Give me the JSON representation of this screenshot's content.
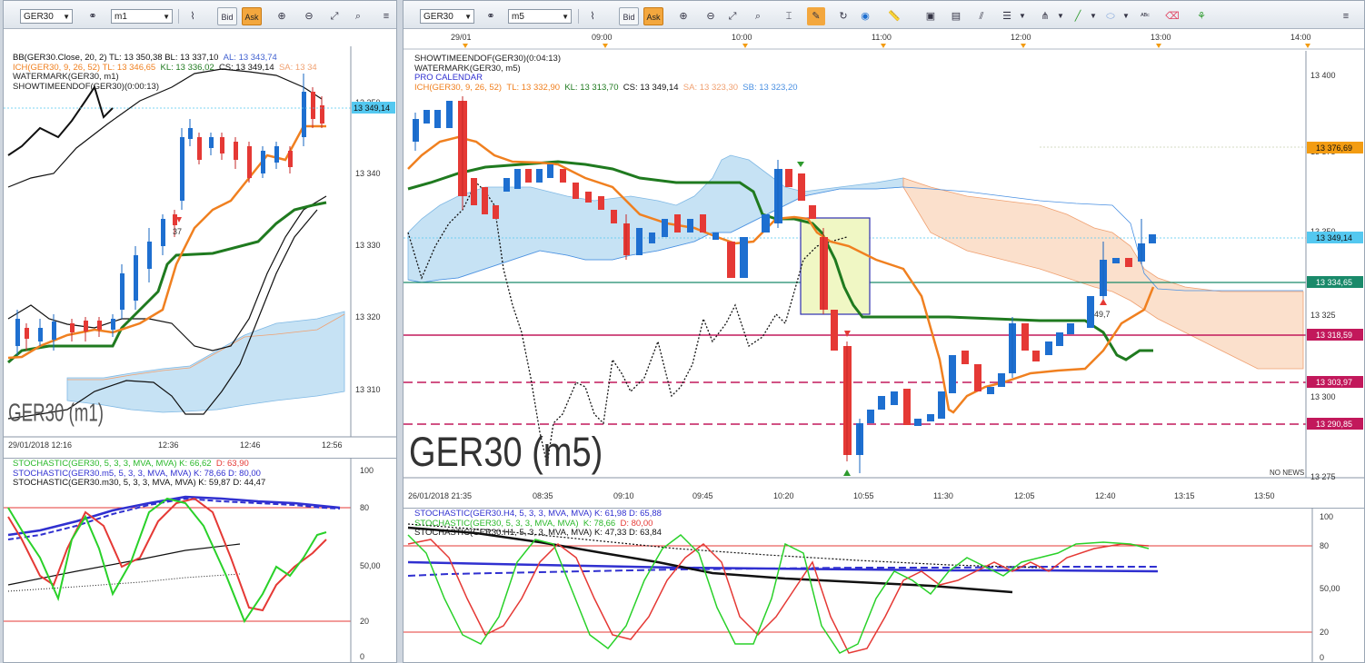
{
  "left": {
    "toolbar": {
      "symbol": "GER30",
      "timeframe": "m1",
      "bid_label": "Bid",
      "ask_label": "Ask"
    },
    "legend": {
      "bb": "BB(GER30.Close, 20, 2)  TL: 13 350,38  BL: 13 337,10",
      "bb_al": "AL: 13 343,74",
      "ich": "ICH(GER30, 9, 26, 52)  TL: 13 346,65",
      "ich_kl": "KL: 13 336,02",
      "ich_cs": "CS: 13 349,14",
      "ich_sa": "SA: 13 34",
      "wm": "WATERMARK(GER30, m1)",
      "ste": "SHOWTIMEENDOF(GER30)(0:00:13)"
    },
    "watermark": "GER30 (m1)",
    "price_tag": "13 349,14",
    "y_ticks": [
      "13 350",
      "13 340",
      "13 330",
      "13 320",
      "13 310"
    ],
    "x_ticks": [
      "29/01/2018 12:16",
      "12:36",
      "12:46",
      "12:56"
    ],
    "marker_label": "37",
    "stoch": {
      "l1": "STOCHASTIC(GER30, 5, 3, 3, MVA, MVA)  K: 66,62",
      "l1d": "D: 63,90",
      "l2": "STOCHASTIC(GER30.m5, 5, 3, 3, MVA, MVA)  K: 78,66  D: 80,00",
      "l3": "STOCHASTIC(GER30.m30, 5, 3, 3, MVA, MVA)  K: 59,87  D: 44,47",
      "y_ticks": [
        "100",
        "80",
        "50,00",
        "20",
        "0"
      ]
    }
  },
  "right": {
    "toolbar": {
      "symbol": "GER30",
      "timeframe": "m5",
      "bid_label": "Bid",
      "ask_label": "Ask"
    },
    "top_time_ticks": [
      "29/01",
      "09:00",
      "10:00",
      "11:00",
      "12:00",
      "13:00",
      "14:00"
    ],
    "legend": {
      "ste": "SHOWTIMEENDOF(GER30)(0:04:13)",
      "wm": "WATERMARK(GER30, m5)",
      "pc": "PRO CALENDAR",
      "ich": "ICH(GER30, 9, 26, 52)",
      "ich_tl": "TL: 13 332,90",
      "ich_kl": "KL: 13 313,70",
      "ich_cs": "CS: 13 349,14",
      "ich_sa": "SA: 13 323,30",
      "ich_sb": "SB: 13 323,20"
    },
    "watermark": "GER30 (m5)",
    "no_news": "NO NEWS",
    "marker_label": "49,7",
    "y_ticks": [
      "13 400",
      "13 375",
      "13 350",
      "13 325",
      "13 300",
      "13 275"
    ],
    "price_tags": [
      {
        "text": "13 376,69",
        "color": "#f39c12"
      },
      {
        "text": "13 349,14",
        "color": "#54c8f0"
      },
      {
        "text": "13 334,65",
        "color": "#1a8a6a"
      },
      {
        "text": "13 318,59",
        "color": "#c2185b"
      },
      {
        "text": "13 303,97",
        "color": "#c2185b"
      },
      {
        "text": "13 290,85",
        "color": "#c2185b"
      }
    ],
    "x_ticks": [
      "26/01/2018 21:35",
      "08:35",
      "09:10",
      "09:45",
      "10:20",
      "10:55",
      "11:30",
      "12:05",
      "12:40",
      "13:15",
      "13:50"
    ],
    "stoch": {
      "l1": "STOCHASTIC(GER30.H4, 5, 3, 3, MVA, MVA)  K: 61,98  D: 65,88",
      "l2": "STOCHASTIC(GER30, 5, 3, 3, MVA, MVA)",
      "l2k": "K: 78,66",
      "l2d": "D: 80,00",
      "l3": "STOCHASTIC(GER30.H1, 5, 3, 3, MVA, MVA)  K: 47,33  D: 63,84",
      "y_ticks": [
        "100",
        "80",
        "50,00",
        "20",
        "0"
      ]
    }
  }
}
